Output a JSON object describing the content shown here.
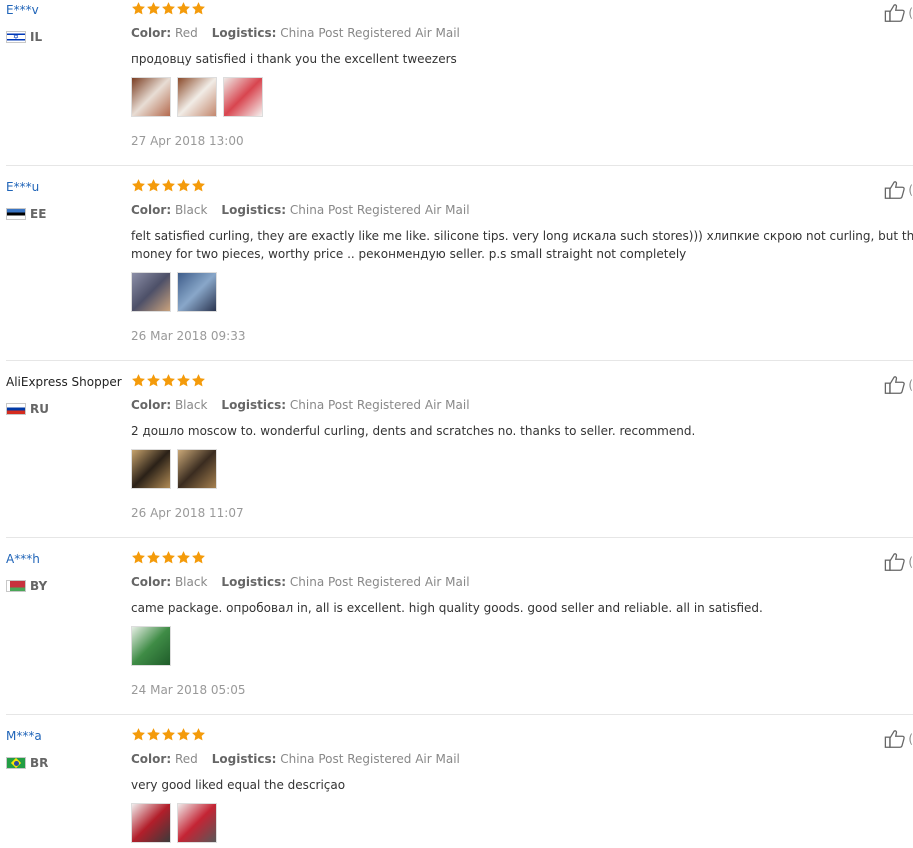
{
  "labels": {
    "color": "Color:",
    "logistics": "Logistics:"
  },
  "reviews": [
    {
      "user": "E***v",
      "user_style": "link",
      "country": "IL",
      "flag": "il",
      "stars": 5,
      "color": "Red",
      "logistics": "China Post Registered Air Mail",
      "text_lines": [
        "продовцу satisfied i thank you the excellent tweezers"
      ],
      "photos": [
        "photo-red-tweezers-1",
        "photo-red-tweezers-2",
        "photo-red-tweezers-3"
      ],
      "date": "27 Apr 2018 13:00",
      "like_count": "("
    },
    {
      "user": "E***u",
      "user_style": "link",
      "country": "EE",
      "flag": "ee",
      "stars": 5,
      "color": "Black",
      "logistics": "China Post Registered Air Mail",
      "text_lines": [
        "felt satisfied curling, they are exactly like me like. silicone tips. very long искала such stores))) хлипкие скрою not curling, but this",
        "money for two pieces, worthy price .. реконмендую seller. p.s small straight not completely"
      ],
      "photos": [
        "photo-curlers-1",
        "photo-curlers-2"
      ],
      "date": "26 Mar 2018 09:33",
      "like_count": "("
    },
    {
      "user": "AliExpress Shopper",
      "user_style": "plain",
      "country": "RU",
      "flag": "ru",
      "stars": 5,
      "color": "Black",
      "logistics": "China Post Registered Air Mail",
      "text_lines": [
        "2 дошло moscow to. wonderful curling, dents and scratches no. thanks to seller. recommend."
      ],
      "photos": [
        "photo-curler-on-wood-1",
        "photo-curler-on-wood-2"
      ],
      "date": "26 Apr 2018 11:07",
      "like_count": "("
    },
    {
      "user": "A***h",
      "user_style": "link",
      "country": "BY",
      "flag": "by",
      "stars": 5,
      "color": "Black",
      "logistics": "China Post Registered Air Mail",
      "text_lines": [
        "came package. опробовал in, all is excellent. high quality goods. good seller and reliable. all in satisfied."
      ],
      "photos": [
        "photo-green-package"
      ],
      "date": "24 Mar 2018 05:05",
      "like_count": "("
    },
    {
      "user": "M***a",
      "user_style": "link",
      "country": "BR",
      "flag": "br",
      "stars": 5,
      "color": "Red",
      "logistics": "China Post Registered Air Mail",
      "text_lines": [
        "very good liked equal the descriçao"
      ],
      "photos": [
        "photo-red-curler-1",
        "photo-red-curler-2"
      ],
      "date": "",
      "like_count": "("
    }
  ],
  "colors": {
    "username": "#1f64b8",
    "star": "#f49b0b",
    "meta": "#888888",
    "divider": "#e6e6e6"
  }
}
